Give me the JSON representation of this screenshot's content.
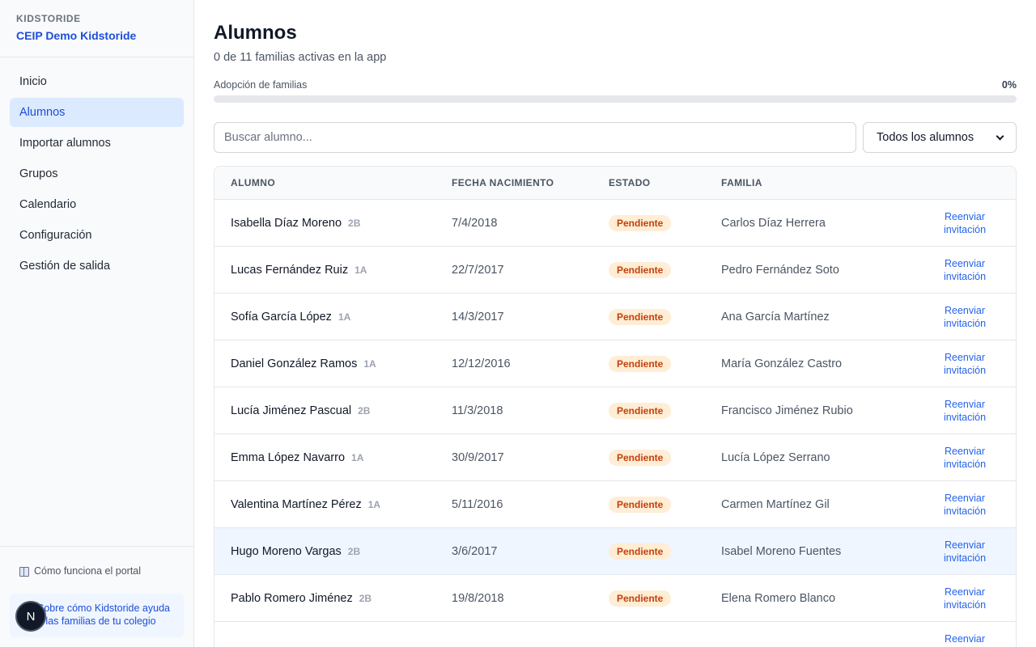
{
  "sidebar": {
    "eyebrow": "KIDSTORIDE",
    "school": "CEIP Demo Kidstoride",
    "items": [
      {
        "label": "Inicio"
      },
      {
        "label": "Alumnos"
      },
      {
        "label": "Importar alumnos"
      },
      {
        "label": "Grupos"
      },
      {
        "label": "Calendario"
      },
      {
        "label": "Configuración"
      },
      {
        "label": "Gestión de salida"
      }
    ],
    "active_index": 1,
    "help_link": "Cómo funciona el portal",
    "info_card": "Sobre cómo Kidstoride ayuda a las familias de tu colegio",
    "avatar_letter": "N"
  },
  "main": {
    "title": "Alumnos",
    "subtitle": "0 de 11 familias activas en la app",
    "progress": {
      "label": "Adopción de familias",
      "value_text": "0%",
      "fraction": 0
    },
    "search_placeholder": "Buscar alumno...",
    "filter_selected": "Todos los alumnos",
    "columns": {
      "student": "ALUMNO",
      "birth": "FECHA NACIMIENTO",
      "status": "ESTADO",
      "family": "FAMILIA"
    },
    "rows": [
      {
        "student": "Isabella Díaz Moreno",
        "group": "2B",
        "birth": "7/4/2018",
        "status": "Pendiente",
        "family": "Carlos Díaz Herrera",
        "action": "Reenviar invitación"
      },
      {
        "student": "Lucas Fernández Ruiz",
        "group": "1A",
        "birth": "22/7/2017",
        "status": "Pendiente",
        "family": "Pedro Fernández Soto",
        "action": "Reenviar invitación"
      },
      {
        "student": "Sofía García López",
        "group": "1A",
        "birth": "14/3/2017",
        "status": "Pendiente",
        "family": "Ana García Martínez",
        "action": "Reenviar invitación"
      },
      {
        "student": "Daniel González Ramos",
        "group": "1A",
        "birth": "12/12/2016",
        "status": "Pendiente",
        "family": "María González Castro",
        "action": "Reenviar invitación"
      },
      {
        "student": "Lucía Jiménez Pascual",
        "group": "2B",
        "birth": "11/3/2018",
        "status": "Pendiente",
        "family": "Francisco Jiménez Rubio",
        "action": "Reenviar invitación"
      },
      {
        "student": "Emma López Navarro",
        "group": "1A",
        "birth": "30/9/2017",
        "status": "Pendiente",
        "family": "Lucía López Serrano",
        "action": "Reenviar invitación"
      },
      {
        "student": "Valentina Martínez Pérez",
        "group": "1A",
        "birth": "5/11/2016",
        "status": "Pendiente",
        "family": "Carmen Martínez Gil",
        "action": "Reenviar invitación"
      },
      {
        "student": "Hugo Moreno Vargas",
        "group": "2B",
        "birth": "3/6/2017",
        "status": "Pendiente",
        "family": "Isabel Moreno Fuentes",
        "action": "Reenviar invitación"
      },
      {
        "student": "Pablo Romero Jiménez",
        "group": "2B",
        "birth": "19/8/2018",
        "status": "Pendiente",
        "family": "Elena Romero Blanco",
        "action": "Reenviar invitación"
      },
      {
        "student": "",
        "group": "",
        "birth": "",
        "status": "",
        "family": "",
        "action": "Reenviar invitación"
      }
    ],
    "hover_row_index": 7
  },
  "colors": {
    "accent": "#2563eb",
    "active_bg": "#dbeafe",
    "pending_bg": "#ffedd5",
    "pending_text": "#c2410c"
  }
}
